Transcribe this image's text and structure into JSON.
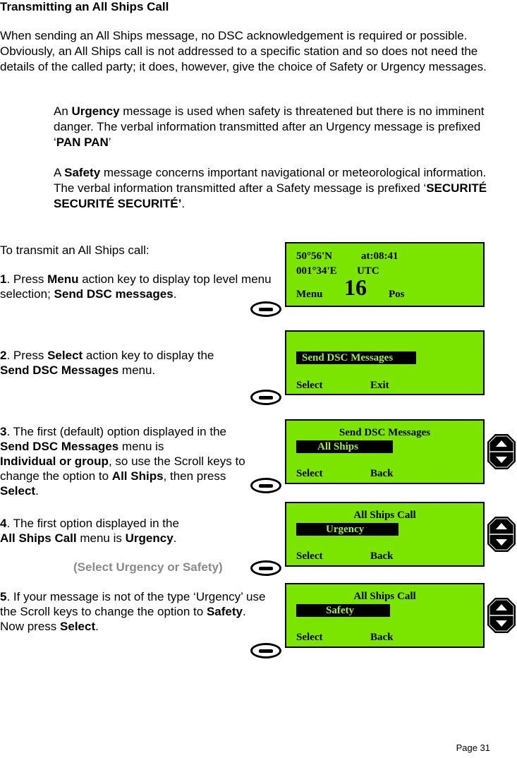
{
  "heading": "Transmitting an All Ships Call",
  "intro": "When sending an All Ships message, no DSC acknowledgement is required or possible. Obviously, an All Ships call is not addressed to a specific station and so does not need the details of the called party; it does, however, give the choice of Safety or Urgency messages.",
  "urgency_para": {
    "pre": "An ",
    "bold1": "Urgency",
    "mid": " message is used when safety is threatened but there is no imminent danger. The verbal information transmitted after an Urgency message is prefixed ‘",
    "bold2": "PAN PAN",
    "post": "’"
  },
  "safety_para": {
    "pre": "A ",
    "bold1": "Safety",
    "mid": " message concerns important navigational or meteorological information. The verbal information transmitted after a Safety message is prefixed ‘",
    "bold2": "SECURITÉ SECURITÉ SECURITÉ’",
    "post": "."
  },
  "steps_intro": "To transmit an All Ships call:",
  "steps": {
    "s1": {
      "num": "1",
      "a": ". Press ",
      "b": "Menu",
      "c": " action key  to  display top level menu selection; ",
      "d": "Send DSC messages",
      "e": "."
    },
    "s2": {
      "num": "2",
      "a": ". Press ",
      "b": "Select",
      "c": " action key to display the ",
      "d": "Send DSC Messages",
      "e": " menu."
    },
    "s3": {
      "num": "3",
      "a": ". The first (default) option displayed in the ",
      "b": "Send DSC Messages",
      "c": " menu is ",
      "d": "Individual or group",
      "e": ", so use the Scroll keys to change the option to ",
      "f": "All Ships",
      "g": ", then press ",
      "h": "Select",
      "i": "."
    },
    "s4": {
      "num": "4",
      "a": ". The first option displayed in the ",
      "b": "All Ships Call",
      "c": " menu is ",
      "d": "Urgency",
      "e": "."
    },
    "s4_note": "(Select Urgency or Safety)",
    "s5": {
      "num": "5",
      "a": ". If your message is not of the type ‘Urgency’ use the Scroll keys to change the option to ",
      "b": "Safety",
      "c": ".",
      "d": "Now press ",
      "e": "Select",
      "f": "."
    }
  },
  "screens": {
    "home": {
      "lat": "50°56'N",
      "time": "at:08:41",
      "lon": "001°34'E",
      "tz": "UTC",
      "left_key": "Menu",
      "channel": "16",
      "right_key": "Pos"
    },
    "top_menu": {
      "item": "Send DSC Messages",
      "left_key": "Select",
      "right_key": "Exit"
    },
    "dsc_menu": {
      "title": "Send DSC Messages",
      "item": "All Ships",
      "left_key": "Select",
      "right_key": "Back"
    },
    "call_urgency": {
      "title": "All Ships Call",
      "item": "Urgency",
      "left_key": "Select",
      "right_key": "Back"
    },
    "call_safety": {
      "title": "All Ships Call",
      "item": "Safety",
      "left_key": "Select",
      "right_key": "Back"
    }
  },
  "colors": {
    "lcd": "#7be500",
    "note": "#8a8a8a"
  },
  "page_label": "Page 31"
}
